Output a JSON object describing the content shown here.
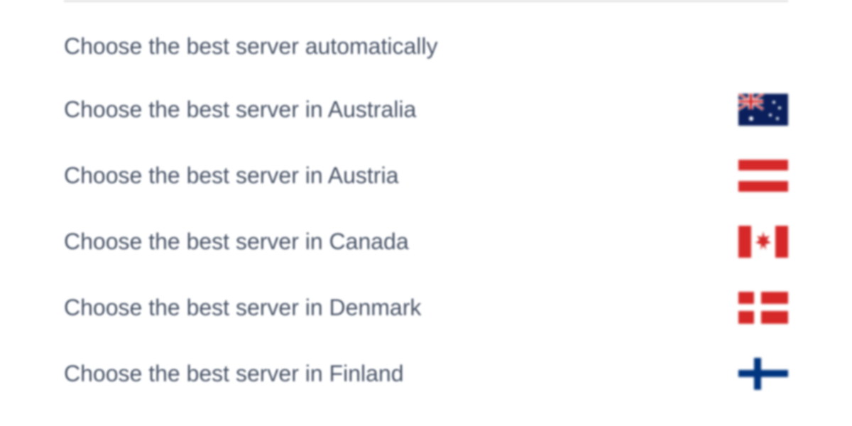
{
  "servers": {
    "items": [
      {
        "label": "Choose the best server automatically",
        "flag": null
      },
      {
        "label": "Choose the best server in Australia",
        "flag": "australia"
      },
      {
        "label": "Choose the best server in Austria",
        "flag": "austria"
      },
      {
        "label": "Choose the best server in Canada",
        "flag": "canada"
      },
      {
        "label": "Choose the best server in Denmark",
        "flag": "denmark"
      },
      {
        "label": "Choose the best server in Finland",
        "flag": "finland"
      }
    ]
  }
}
